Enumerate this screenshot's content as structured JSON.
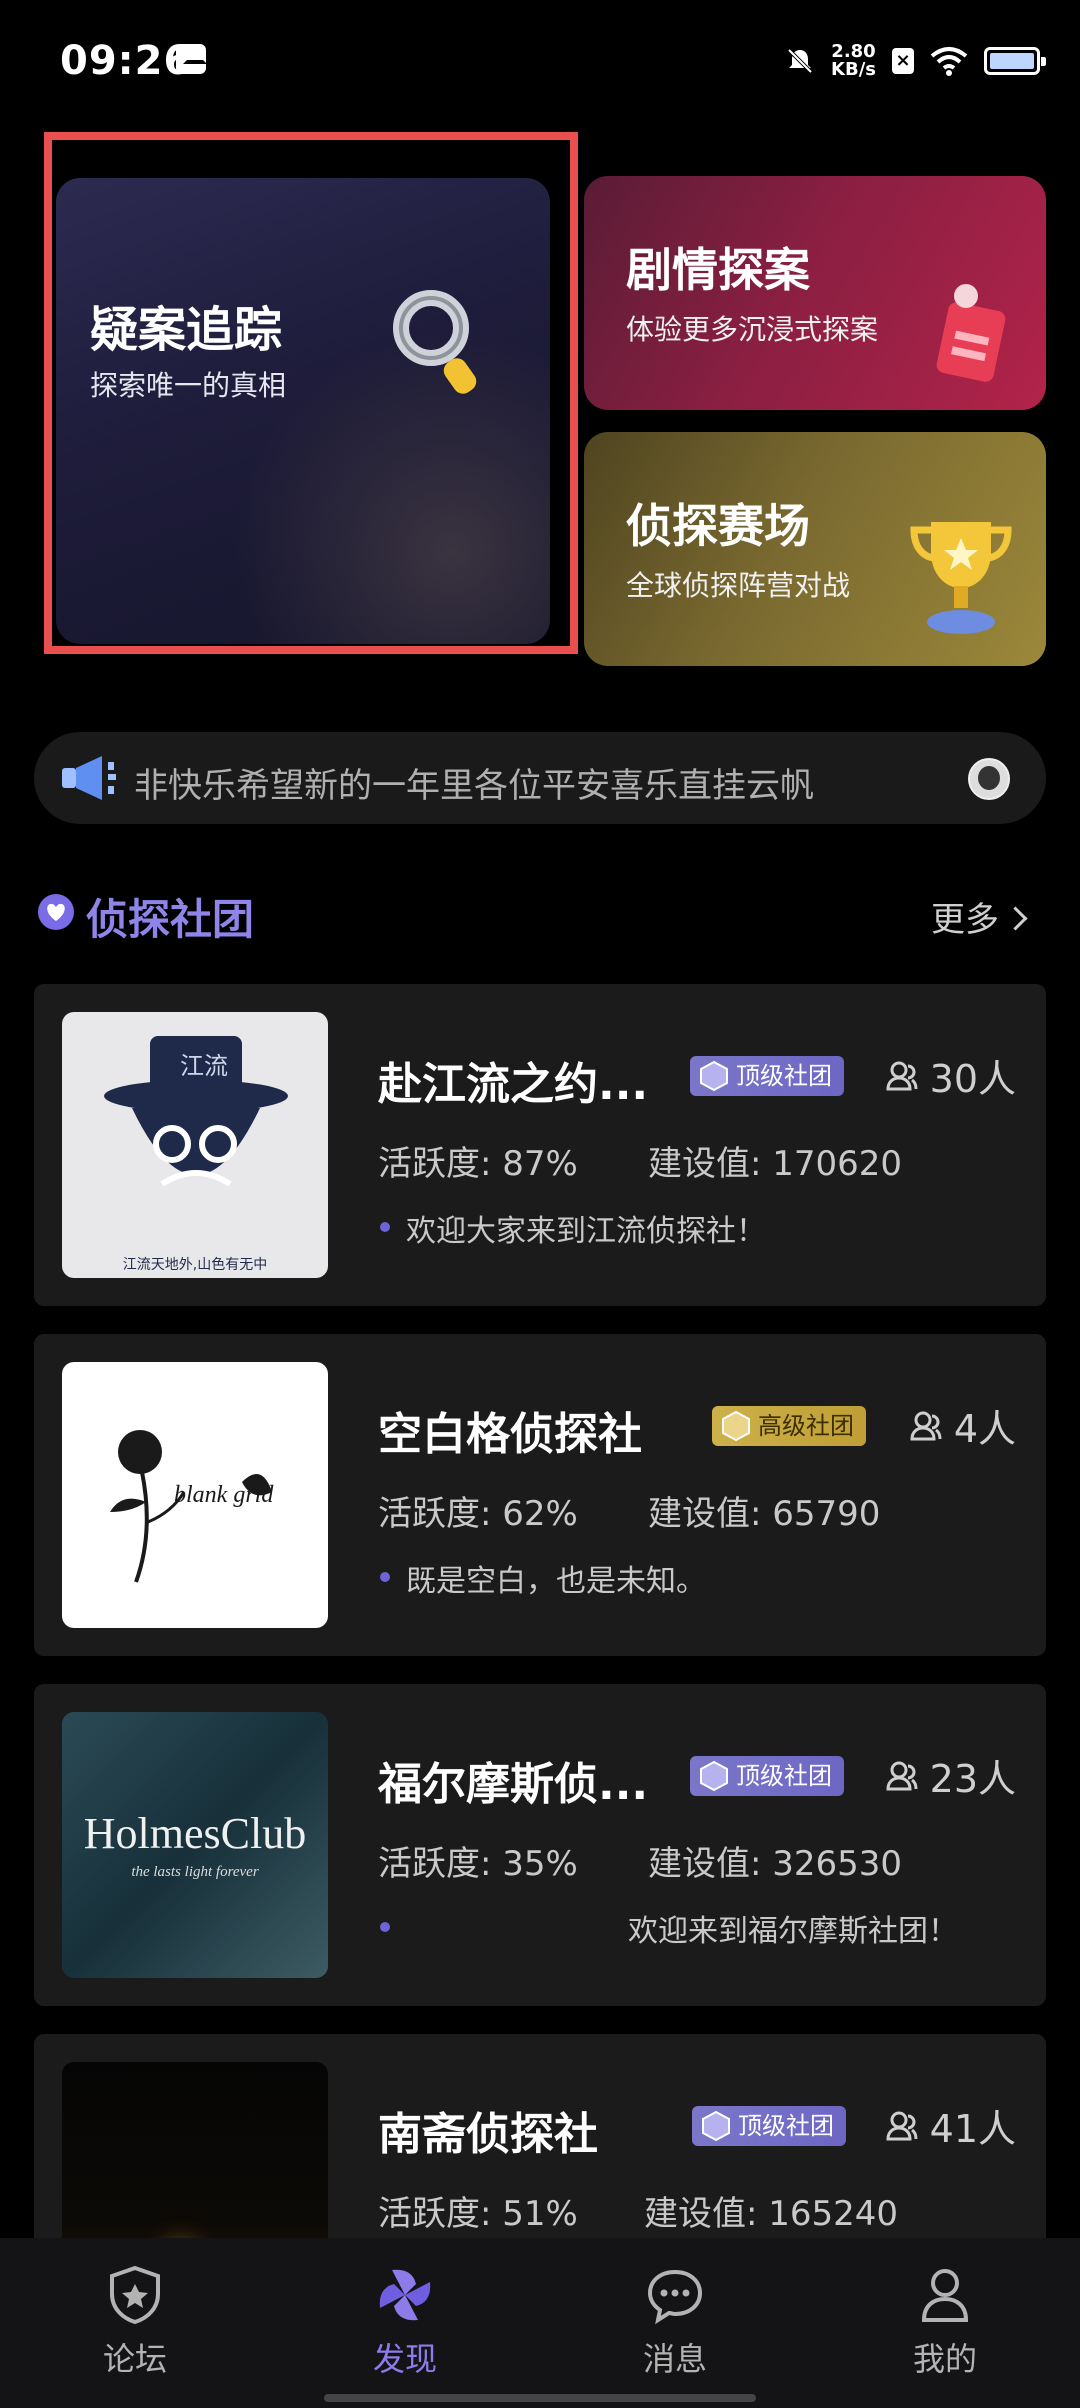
{
  "status_bar": {
    "time": "09:26",
    "net_speed_value": "2.80",
    "net_speed_unit": "KB/s"
  },
  "features": {
    "case_tracking": {
      "title": "疑案追踪",
      "subtitle": "探索唯一的真相"
    },
    "story_case": {
      "title": "剧情探案",
      "subtitle": "体验更多沉浸式探案"
    },
    "arena": {
      "title": "侦探赛场",
      "subtitle": "全球侦探阵营对战"
    }
  },
  "announcement": {
    "text": "非快乐希望新的一年里各位平安喜乐直挂云帆"
  },
  "clubs_section": {
    "title": "侦探社团",
    "more": "更多"
  },
  "clubs": [
    {
      "name": "赴江流之约...",
      "badge": "顶级社团",
      "members": "30人",
      "activity": "活跃度: 87%",
      "build": "建设值: 170620",
      "welcome": "欢迎大家来到江流侦探社！",
      "logo_caption": "江流天地外,山色有无中"
    },
    {
      "name": "空白格侦探社",
      "badge": "高级社团",
      "members": "4人",
      "activity": "活跃度: 62%",
      "build": "建设值: 65790",
      "welcome": "既是空白，也是未知。",
      "logo_text": "blank grid"
    },
    {
      "name": "福尔摩斯侦...",
      "badge": "顶级社团",
      "members": "23人",
      "activity": "活跃度: 35%",
      "build": "建设值: 326530",
      "welcome": "欢迎来到福尔摩斯社团！",
      "logo_text": "HolmesClub",
      "logo_sub": "the lasts light forever"
    },
    {
      "name": "南斋侦探社",
      "badge": "顶级社团",
      "members": "41人",
      "activity": "活跃度: 51%",
      "build": "建设值: 165240",
      "welcome": ""
    }
  ],
  "bottom_nav": [
    {
      "label": "论坛",
      "icon": "shield-star-icon"
    },
    {
      "label": "发现",
      "icon": "pinwheel-icon",
      "active": true
    },
    {
      "label": "消息",
      "icon": "chat-bubble-icon"
    },
    {
      "label": "我的",
      "icon": "person-icon"
    }
  ],
  "colors": {
    "accent": "#8d7be9",
    "highlight_border": "#ea4f4f",
    "top_badge": "#7a77c9",
    "high_badge": "#cdb04a"
  }
}
